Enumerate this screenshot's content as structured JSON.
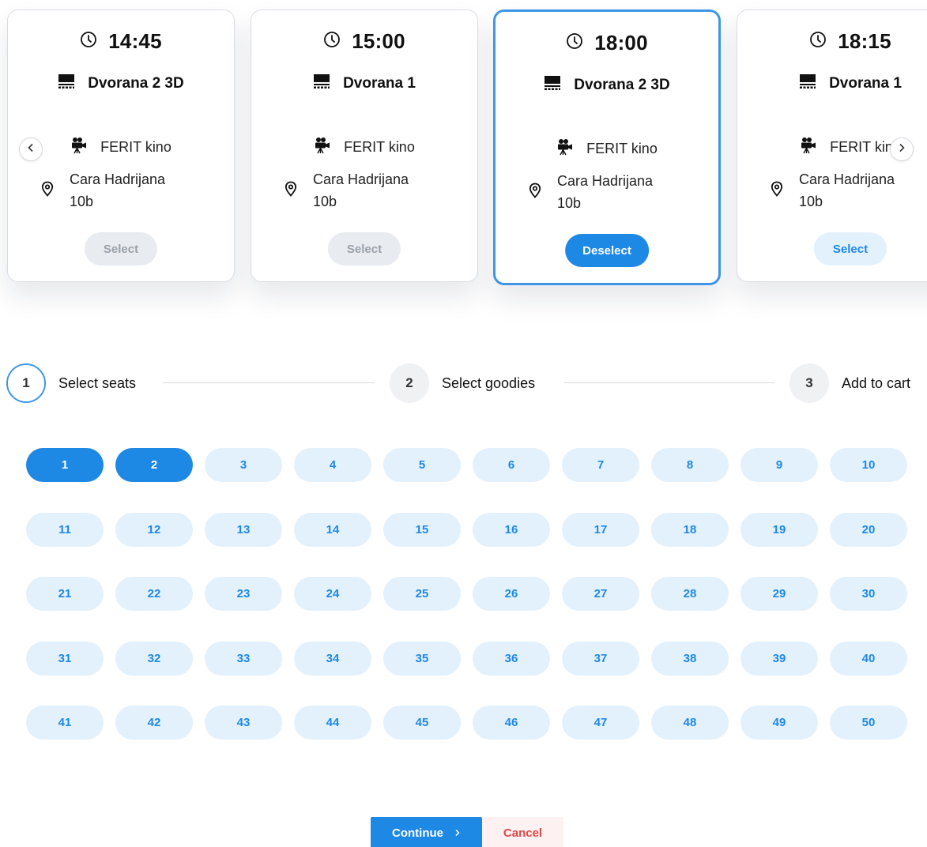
{
  "showtimes": [
    {
      "time": "14:45",
      "hall": "Dvorana 2 3D",
      "cinema": "FERIT kino",
      "address": "Cara Hadrijana 10b",
      "button": "Select",
      "state": "disabled"
    },
    {
      "time": "15:00",
      "hall": "Dvorana 1",
      "cinema": "FERIT kino",
      "address": "Cara Hadrijana 10b",
      "button": "Select",
      "state": "disabled"
    },
    {
      "time": "18:00",
      "hall": "Dvorana 2 3D",
      "cinema": "FERIT kino",
      "address": "Cara Hadrijana 10b",
      "button": "Deselect",
      "state": "selected"
    },
    {
      "time": "18:15",
      "hall": "Dvorana 1",
      "cinema": "FERIT kino",
      "address": "Cara Hadrijana 10b",
      "button": "Select",
      "state": "available"
    }
  ],
  "carousel": {
    "prev_icon": "chevron-left-icon",
    "next_icon": "chevron-right-icon"
  },
  "stepper": {
    "steps": [
      {
        "number": "1",
        "label": "Select seats",
        "active": true
      },
      {
        "number": "2",
        "label": "Select goodies",
        "active": false
      },
      {
        "number": "3",
        "label": "Add to cart",
        "active": false
      }
    ]
  },
  "seats": {
    "labels": [
      "1",
      "2",
      "3",
      "4",
      "5",
      "6",
      "7",
      "8",
      "9",
      "10",
      "11",
      "12",
      "13",
      "14",
      "15",
      "16",
      "17",
      "18",
      "19",
      "20",
      "21",
      "22",
      "23",
      "24",
      "25",
      "26",
      "27",
      "28",
      "29",
      "30",
      "31",
      "32",
      "33",
      "34",
      "35",
      "36",
      "37",
      "38",
      "39",
      "40",
      "41",
      "42",
      "43",
      "44",
      "45",
      "46",
      "47",
      "48",
      "49",
      "50"
    ],
    "selected": [
      "1",
      "2"
    ]
  },
  "actions": {
    "continue_label": "Continue",
    "continue_icon": "chevron-right-icon",
    "cancel_label": "Cancel"
  },
  "colors": {
    "accent": "#1e88e5",
    "accent_light": "#e3f1fd",
    "danger": "#e04848"
  }
}
